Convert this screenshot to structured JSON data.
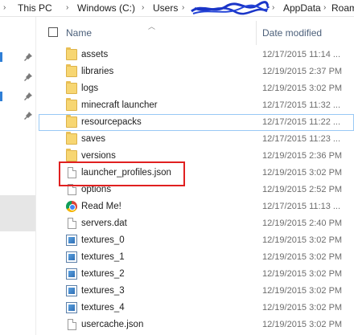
{
  "address_bar": {
    "segments": [
      "This PC",
      "Windows (C:)",
      "Users",
      "AppData",
      "Roam"
    ]
  },
  "header": {
    "name_label": "Name",
    "date_label": "Date modified"
  },
  "files": [
    {
      "name": "assets",
      "date": "12/17/2015 11:14 ...",
      "icon": "folder-icon"
    },
    {
      "name": "libraries",
      "date": "12/19/2015 2:37 PM",
      "icon": "folder-icon"
    },
    {
      "name": "logs",
      "date": "12/19/2015 3:02 PM",
      "icon": "folder-icon"
    },
    {
      "name": "minecraft launcher",
      "date": "12/17/2015 11:32 ...",
      "icon": "folder-icon"
    },
    {
      "name": "resourcepacks",
      "date": "12/17/2015 11:22 ...",
      "icon": "folder-icon"
    },
    {
      "name": "saves",
      "date": "12/17/2015 11:23 ...",
      "icon": "folder-icon"
    },
    {
      "name": "versions",
      "date": "12/19/2015 2:36 PM",
      "icon": "folder-icon"
    },
    {
      "name": "launcher_profiles.json",
      "date": "12/19/2015 3:02 PM",
      "icon": "file-icon"
    },
    {
      "name": "options",
      "date": "12/19/2015 2:52 PM",
      "icon": "file-icon"
    },
    {
      "name": "Read Me!",
      "date": "12/17/2015 11:13 ...",
      "icon": "chrome-icon"
    },
    {
      "name": "servers.dat",
      "date": "12/19/2015 2:40 PM",
      "icon": "file-icon"
    },
    {
      "name": "textures_0",
      "date": "12/19/2015 3:02 PM",
      "icon": "image-icon"
    },
    {
      "name": "textures_1",
      "date": "12/19/2015 3:02 PM",
      "icon": "image-icon"
    },
    {
      "name": "textures_2",
      "date": "12/19/2015 3:02 PM",
      "icon": "image-icon"
    },
    {
      "name": "textures_3",
      "date": "12/19/2015 3:02 PM",
      "icon": "image-icon"
    },
    {
      "name": "textures_4",
      "date": "12/19/2015 3:02 PM",
      "icon": "image-icon"
    },
    {
      "name": "usercache.json",
      "date": "12/19/2015 3:02 PM",
      "icon": "file-icon"
    }
  ],
  "colors": {
    "highlight_box": "#e02020",
    "selection_outline": "#99c9f5",
    "header_text": "#4c607a"
  }
}
